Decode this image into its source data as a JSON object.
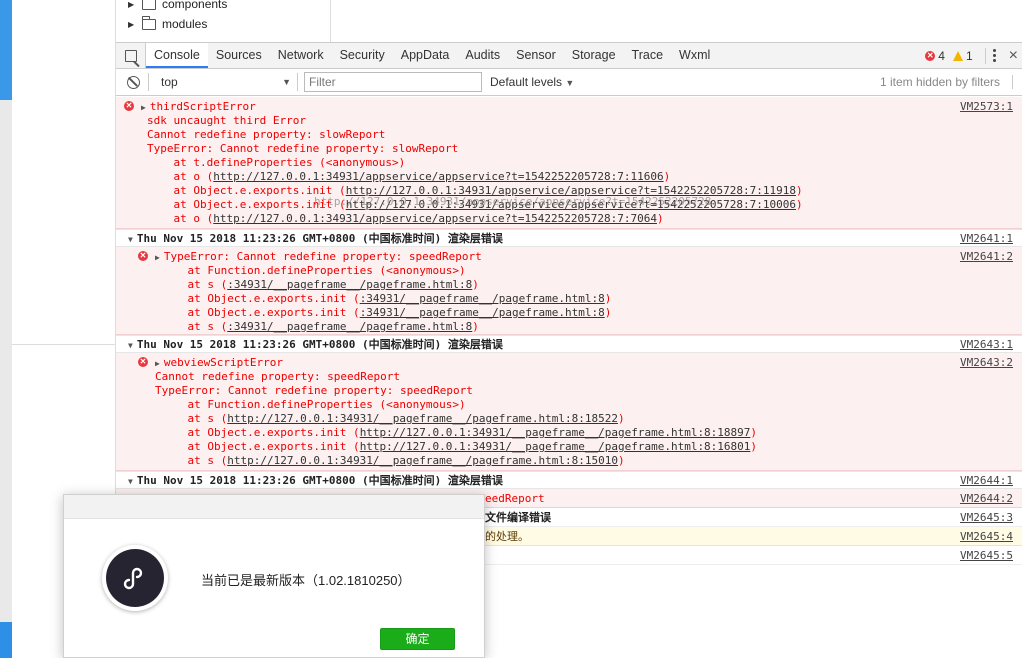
{
  "file_tree": [
    {
      "label": "components"
    },
    {
      "label": "modules"
    }
  ],
  "tabs": [
    "Console",
    "Sources",
    "Network",
    "Security",
    "AppData",
    "Audits",
    "Sensor",
    "Storage",
    "Trace",
    "Wxml"
  ],
  "active_tab": "Console",
  "status": {
    "errors": "4",
    "warnings": "1"
  },
  "filterbar": {
    "context": "top",
    "filter_placeholder": "Filter",
    "levels": "Default levels",
    "hidden_note": "1 item hidden by filters"
  },
  "messages": {
    "m1": {
      "source": "VM2573:1",
      "lines": [
        "thirdScriptError",
        "sdk uncaught third Error",
        "Cannot redefine property: slowReport",
        "TypeError: Cannot redefine property: slowReport",
        "    at t.defineProperties (<anonymous>)",
        "    at o (",
        "    at Object.e.exports.init (",
        "    at Object.e.exports.init (",
        "    at o ("
      ],
      "links": [
        "http://127.0.0.1:34931/appservice/appservice?t=1542252205728:7:11606",
        "http://127.0.0.1:34931/appservice/appservice?t=1542252205728:7:11918",
        "http://127.0.0.1:34931/appservice/appservice?t=1542252205728:7:10006",
        "http://127.0.0.1:34931/appservice/appservice?t=1542252205728:7:7064"
      ],
      "overlay": "http://127.0.0.1:34931/appservice/appservice?t=1542252205728"
    },
    "g1": {
      "title": "Thu Nov 15 2018 11:23:26 GMT+0800 (中国标准时间) 渲染层错误",
      "source": "VM2641:1"
    },
    "m2": {
      "source": "VM2641:2",
      "lines": [
        "TypeError: Cannot redefine property: speedReport",
        "    at Function.defineProperties (<anonymous>)",
        "    at s (",
        "    at Object.e.exports.init (",
        "    at Object.e.exports.init (",
        "    at s ("
      ],
      "links": [
        ":34931/__pageframe__/pageframe.html:8",
        ":34931/__pageframe__/pageframe.html:8",
        ":34931/__pageframe__/pageframe.html:8",
        ":34931/__pageframe__/pageframe.html:8"
      ]
    },
    "g2": {
      "title": "Thu Nov 15 2018 11:23:26 GMT+0800 (中国标准时间) 渲染层错误",
      "source": "VM2643:1"
    },
    "m3": {
      "source": "VM2643:2",
      "lines": [
        "webviewScriptError",
        "Cannot redefine property: speedReport",
        "TypeError: Cannot redefine property: speedReport",
        "    at Function.defineProperties (<anonymous>)",
        "    at s (",
        "    at Object.e.exports.init (",
        "    at Object.e.exports.init (",
        "    at s ("
      ],
      "links": [
        "http://127.0.0.1:34931/__pageframe__/pageframe.html:8:18522",
        "http://127.0.0.1:34931/__pageframe__/pageframe.html:8:18897",
        "http://127.0.0.1:34931/__pageframe__/pageframe.html:8:16801",
        "http://127.0.0.1:34931/__pageframe__/pageframe.html:8:15010"
      ]
    },
    "g3": {
      "title": "Thu Nov 15 2018 11:23:26 GMT+0800 (中国标准时间) 渲染层错误",
      "source": "VM2644:1"
    },
    "m4": {
      "text": "eedReport",
      "source": "VM2644:2"
    },
    "m5": {
      "text": "文件编译错误",
      "source": "VM2645:3"
    },
    "m6": {
      "text": "的处理。",
      "source": "VM2645:4"
    },
    "m7": {
      "source": "VM2645:5"
    }
  },
  "dialog": {
    "message": "当前已是最新版本（1.02.1810250）",
    "ok_label": "确定"
  },
  "colors": {
    "error": "#e5393e",
    "ok_button": "#1aad19",
    "active_tab": "#2d7cf6"
  }
}
